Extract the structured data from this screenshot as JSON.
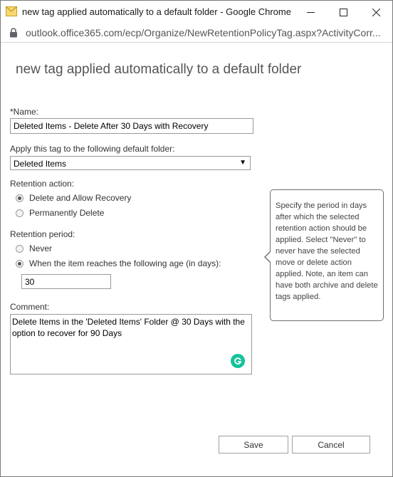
{
  "window": {
    "title": "new tag applied automatically to a default folder - Google Chrome",
    "url": "outlook.office365.com/ecp/Organize/NewRetentionPolicyTag.aspx?ActivityCorr..."
  },
  "page": {
    "title": "new tag applied automatically to a default folder"
  },
  "form": {
    "name_label": "*Name:",
    "name_value": "Deleted Items - Delete After 30 Days with Recovery",
    "folder_label": "Apply this tag to the following default folder:",
    "folder_value": "Deleted Items",
    "folder_arrow": "▼",
    "retention_action_label": "Retention action:",
    "retention_actions": [
      {
        "label": "Delete and Allow Recovery",
        "checked": true
      },
      {
        "label": "Permanently Delete",
        "checked": false
      }
    ],
    "retention_period_label": "Retention period:",
    "retention_periods": [
      {
        "label": "Never",
        "checked": false
      },
      {
        "label": "When the item reaches the following age (in days):",
        "checked": true
      }
    ],
    "age_days_value": "30",
    "comment_label": "Comment:",
    "comment_value": "Delete Items in the 'Deleted Items' Folder @ 30 Days with the option to recover for 90 Days"
  },
  "tooltip": {
    "text": "Specify the period in days after which the selected retention action should be applied. Select \"Never\" to never have the selected move or delete action applied. Note, an item can have both archive and delete tags applied."
  },
  "buttons": {
    "save": "Save",
    "cancel": "Cancel"
  },
  "colors": {
    "grammarly": "#15c39a",
    "border": "#9a9a9a"
  }
}
